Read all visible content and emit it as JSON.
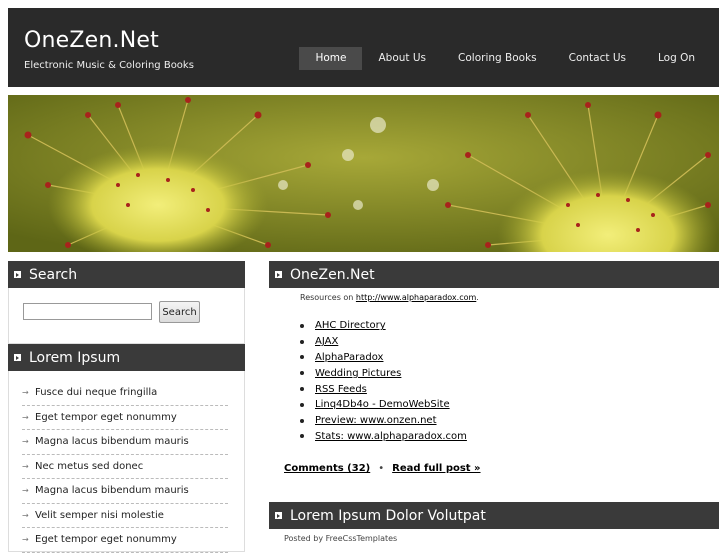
{
  "header": {
    "title": "OneZen.Net",
    "subtitle": "Electronic Music & Coloring Books",
    "nav": [
      "Home",
      "About Us",
      "Coloring Books",
      "Contact Us",
      "Log On"
    ],
    "active_nav": "Home"
  },
  "sidebar": {
    "search": {
      "heading": "Search",
      "input_value": "",
      "button_label": "Search"
    },
    "lorem": {
      "heading": "Lorem Ipsum",
      "items": [
        "Fusce dui neque fringilla",
        "Eget tempor eget nonummy",
        "Magna lacus bibendum mauris",
        "Nec metus sed donec",
        "Magna lacus bibendum mauris",
        "Velit semper nisi molestie",
        "Eget tempor eget nonummy"
      ]
    }
  },
  "main": {
    "post1": {
      "heading": "OneZen.Net",
      "meta_prefix": "Resources on ",
      "meta_link": "http://www.alphaparadox.com",
      "meta_suffix": ".",
      "links": [
        "AHC Directory",
        "AJAX",
        "AlphaParadox",
        "Wedding Pictures",
        "RSS Feeds",
        "Linq4Db4o - DemoWebSite",
        "Preview: www.onzen.net",
        "Stats: www.alphaparadox.com"
      ],
      "comments": "Comments (32)",
      "separator": "•",
      "read_more": "Read full post »"
    },
    "post2": {
      "heading": "Lorem Ipsum Dolor Volutpat",
      "posted_by": "Posted by FreeCssTemplates"
    }
  },
  "colors": {
    "header_bg": "#2a2a2a",
    "panel_bg": "#3a3a3a",
    "nav_active_bg": "#4a4a4a"
  }
}
